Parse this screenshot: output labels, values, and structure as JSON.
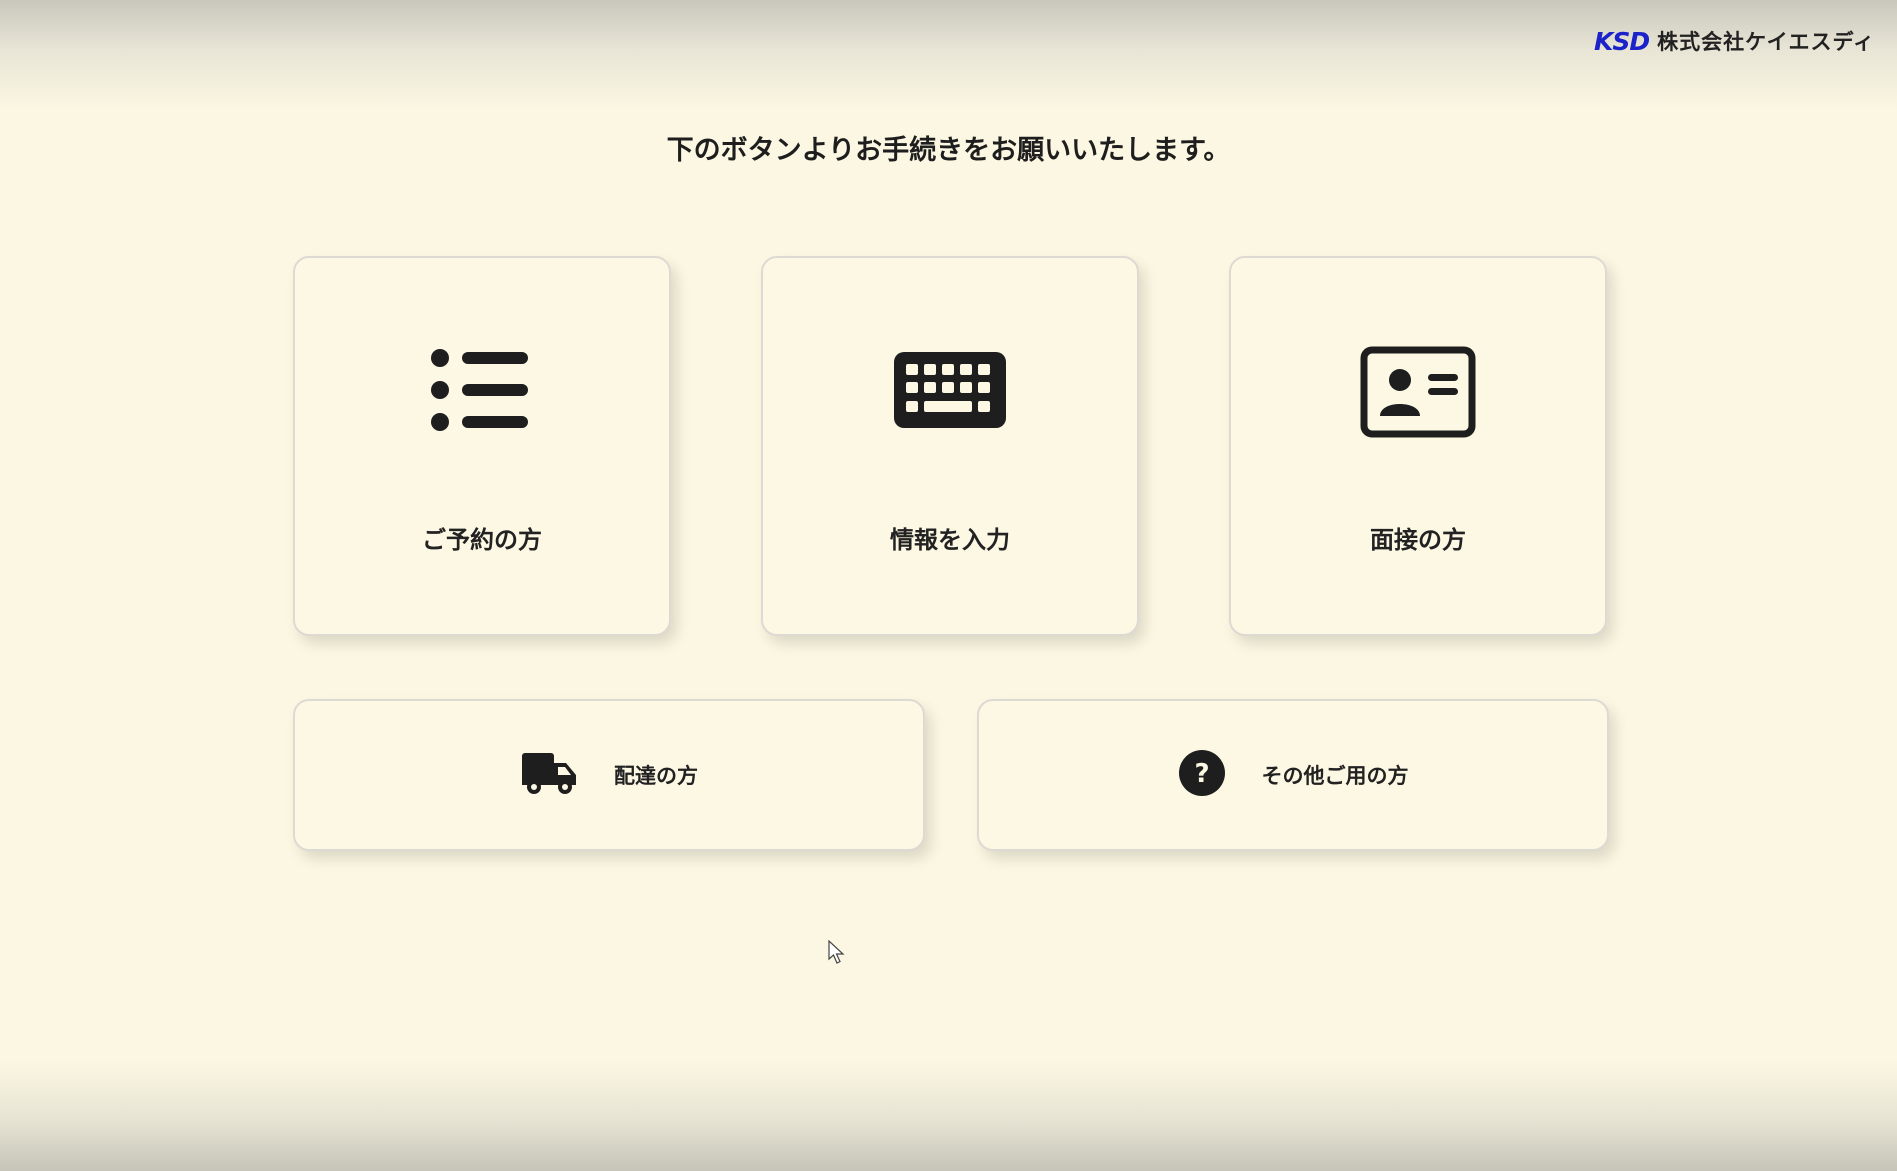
{
  "header": {
    "logo_mark": "KSD",
    "company_name": "株式会社ケイエスディ"
  },
  "instruction": "下のボタンよりお手続きをお願いいたします。",
  "buttons": {
    "reservation": {
      "label": "ご予約の方",
      "icon": "list-icon"
    },
    "enter_info": {
      "label": "情報を入力",
      "icon": "keyboard-icon"
    },
    "interview": {
      "label": "面接の方",
      "icon": "id-card-icon"
    },
    "delivery": {
      "label": "配達の方",
      "icon": "truck-icon"
    },
    "other": {
      "label": "その他ご用の方",
      "icon": "question-circle-icon"
    }
  },
  "colors": {
    "background": "#fbf7e2",
    "card": "#fdf8e4",
    "logo_blue": "#1b22c9",
    "icon": "#1e1e1e"
  }
}
